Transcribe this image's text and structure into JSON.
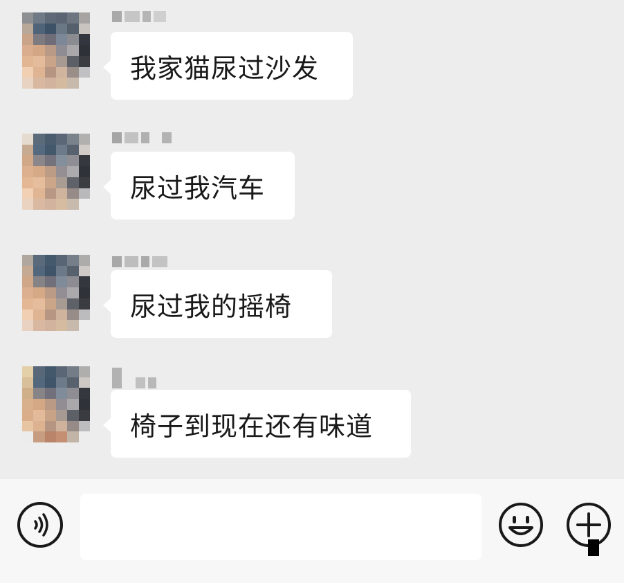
{
  "messages": [
    {
      "text": "我家猫尿过沙发"
    },
    {
      "text": "尿过我汽车"
    },
    {
      "text": "尿过我的摇椅"
    },
    {
      "text": "椅子到现在还有味道"
    }
  ],
  "input": {
    "value": "",
    "placeholder": ""
  },
  "icons": {
    "voice": "voice-wave-icon",
    "emoji": "smiley-face-icon",
    "plus": "plus-circle-icon"
  },
  "colors": {
    "chat_background": "#ededed",
    "bubble": "#ffffff",
    "input_bar": "#f7f7f7",
    "text": "#191919",
    "pixelated_name": "#b9b9b9"
  }
}
